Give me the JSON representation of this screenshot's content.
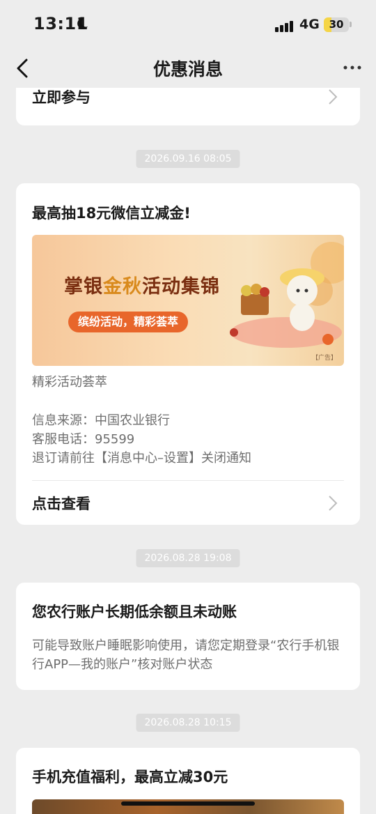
{
  "status": {
    "time": "13:11",
    "network": "4G",
    "battery": "30",
    "battery_level": 0.3
  },
  "nav": {
    "title": "优惠消息"
  },
  "prev_card": {
    "action_label": "立即参与"
  },
  "messages": [
    {
      "timestamp": "2026.09.16 08:05",
      "title": "最高抽18元微信立减金!",
      "banner": {
        "title_part1": "掌银",
        "title_gold": "金秋",
        "title_part2": "活动集锦",
        "subtitle": "缤纷活动，精彩荟萃",
        "ad_tag": "【广告】"
      },
      "summary": "精彩活动荟萃",
      "source": "信息来源：中国农业银行",
      "hotline": "客服电话：95599",
      "unsubscribe": "退订请前往【消息中心–设置】关闭通知",
      "action_label": "点击查看"
    },
    {
      "timestamp": "2026.08.28 19:08",
      "title": "您农行账户长期低余额且未动账",
      "body": "可能导致账户睡眠影响使用，请您定期登录“农行手机银行APP—我的账户”核对账户状态"
    },
    {
      "timestamp": "2026.08.28 10:15",
      "title": "手机充值福利，最高立减30元"
    }
  ],
  "colors": {
    "background": "#ededed",
    "card": "#ffffff",
    "timestamp_bg": "#dcdcdc",
    "banner_accent": "#e8662b"
  }
}
